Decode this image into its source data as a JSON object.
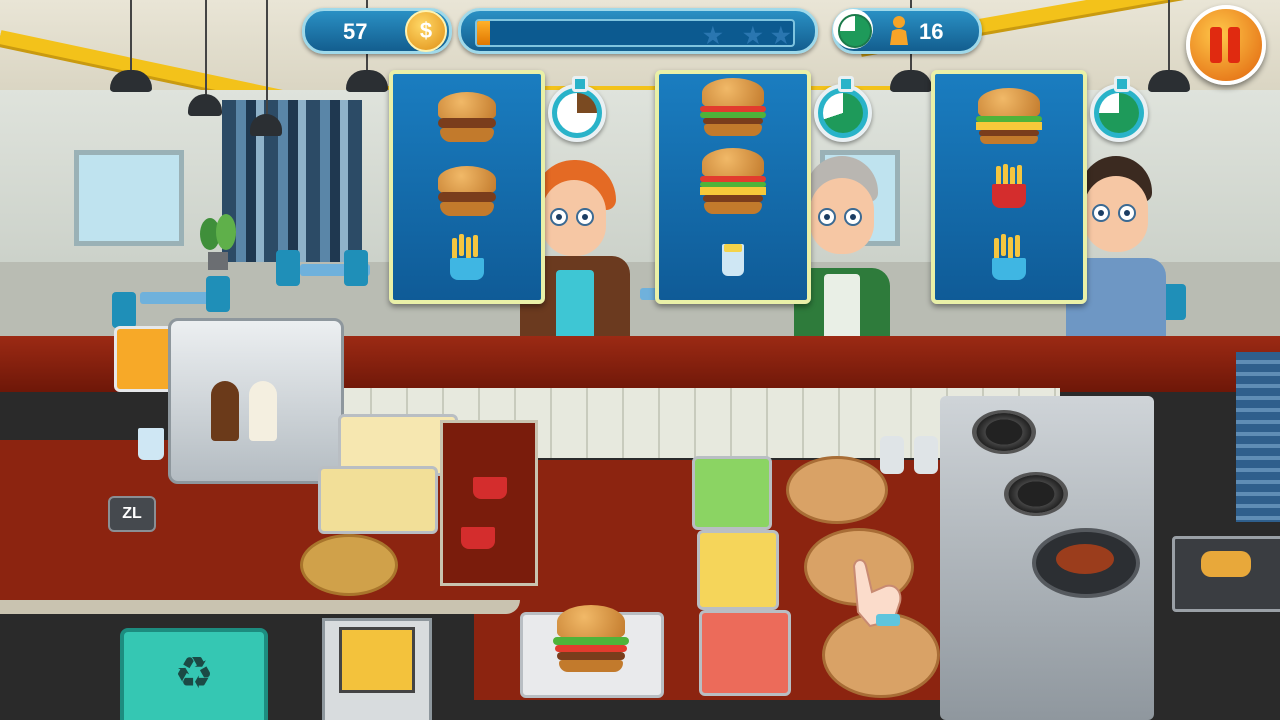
{
  "hud": {
    "coins": "57",
    "coin_symbol": "$",
    "level_progress": 0.04,
    "stars_total": 3,
    "star_glyph": "★",
    "customers_remaining": "16",
    "pause_icon": "pause-icon"
  },
  "controls": {
    "zl_label": "ZL",
    "recycle_glyph": "♻"
  },
  "orders": [
    {
      "items": [
        "burger-plain",
        "burger-plain",
        "fries"
      ],
      "timer_remaining": 0.25,
      "timer_color": "#7a4a21"
    },
    {
      "items": [
        "burger-lettuce-tomato",
        "burger-cheese-lettuce-tomato",
        "drink"
      ],
      "timer_remaining": 0.7,
      "timer_color": "#1e9a5a"
    },
    {
      "items": [
        "burger-cheese-lettuce",
        "fries-box",
        "fries"
      ],
      "timer_remaining": 0.75,
      "timer_color": "#1e9a5a"
    }
  ],
  "colors": {
    "hud_blue": "#135e8f",
    "progress_orange": "#f08a10",
    "pause_red": "#e02a10",
    "card_border": "#e9f0a8",
    "counter_red": "#8c2410"
  }
}
